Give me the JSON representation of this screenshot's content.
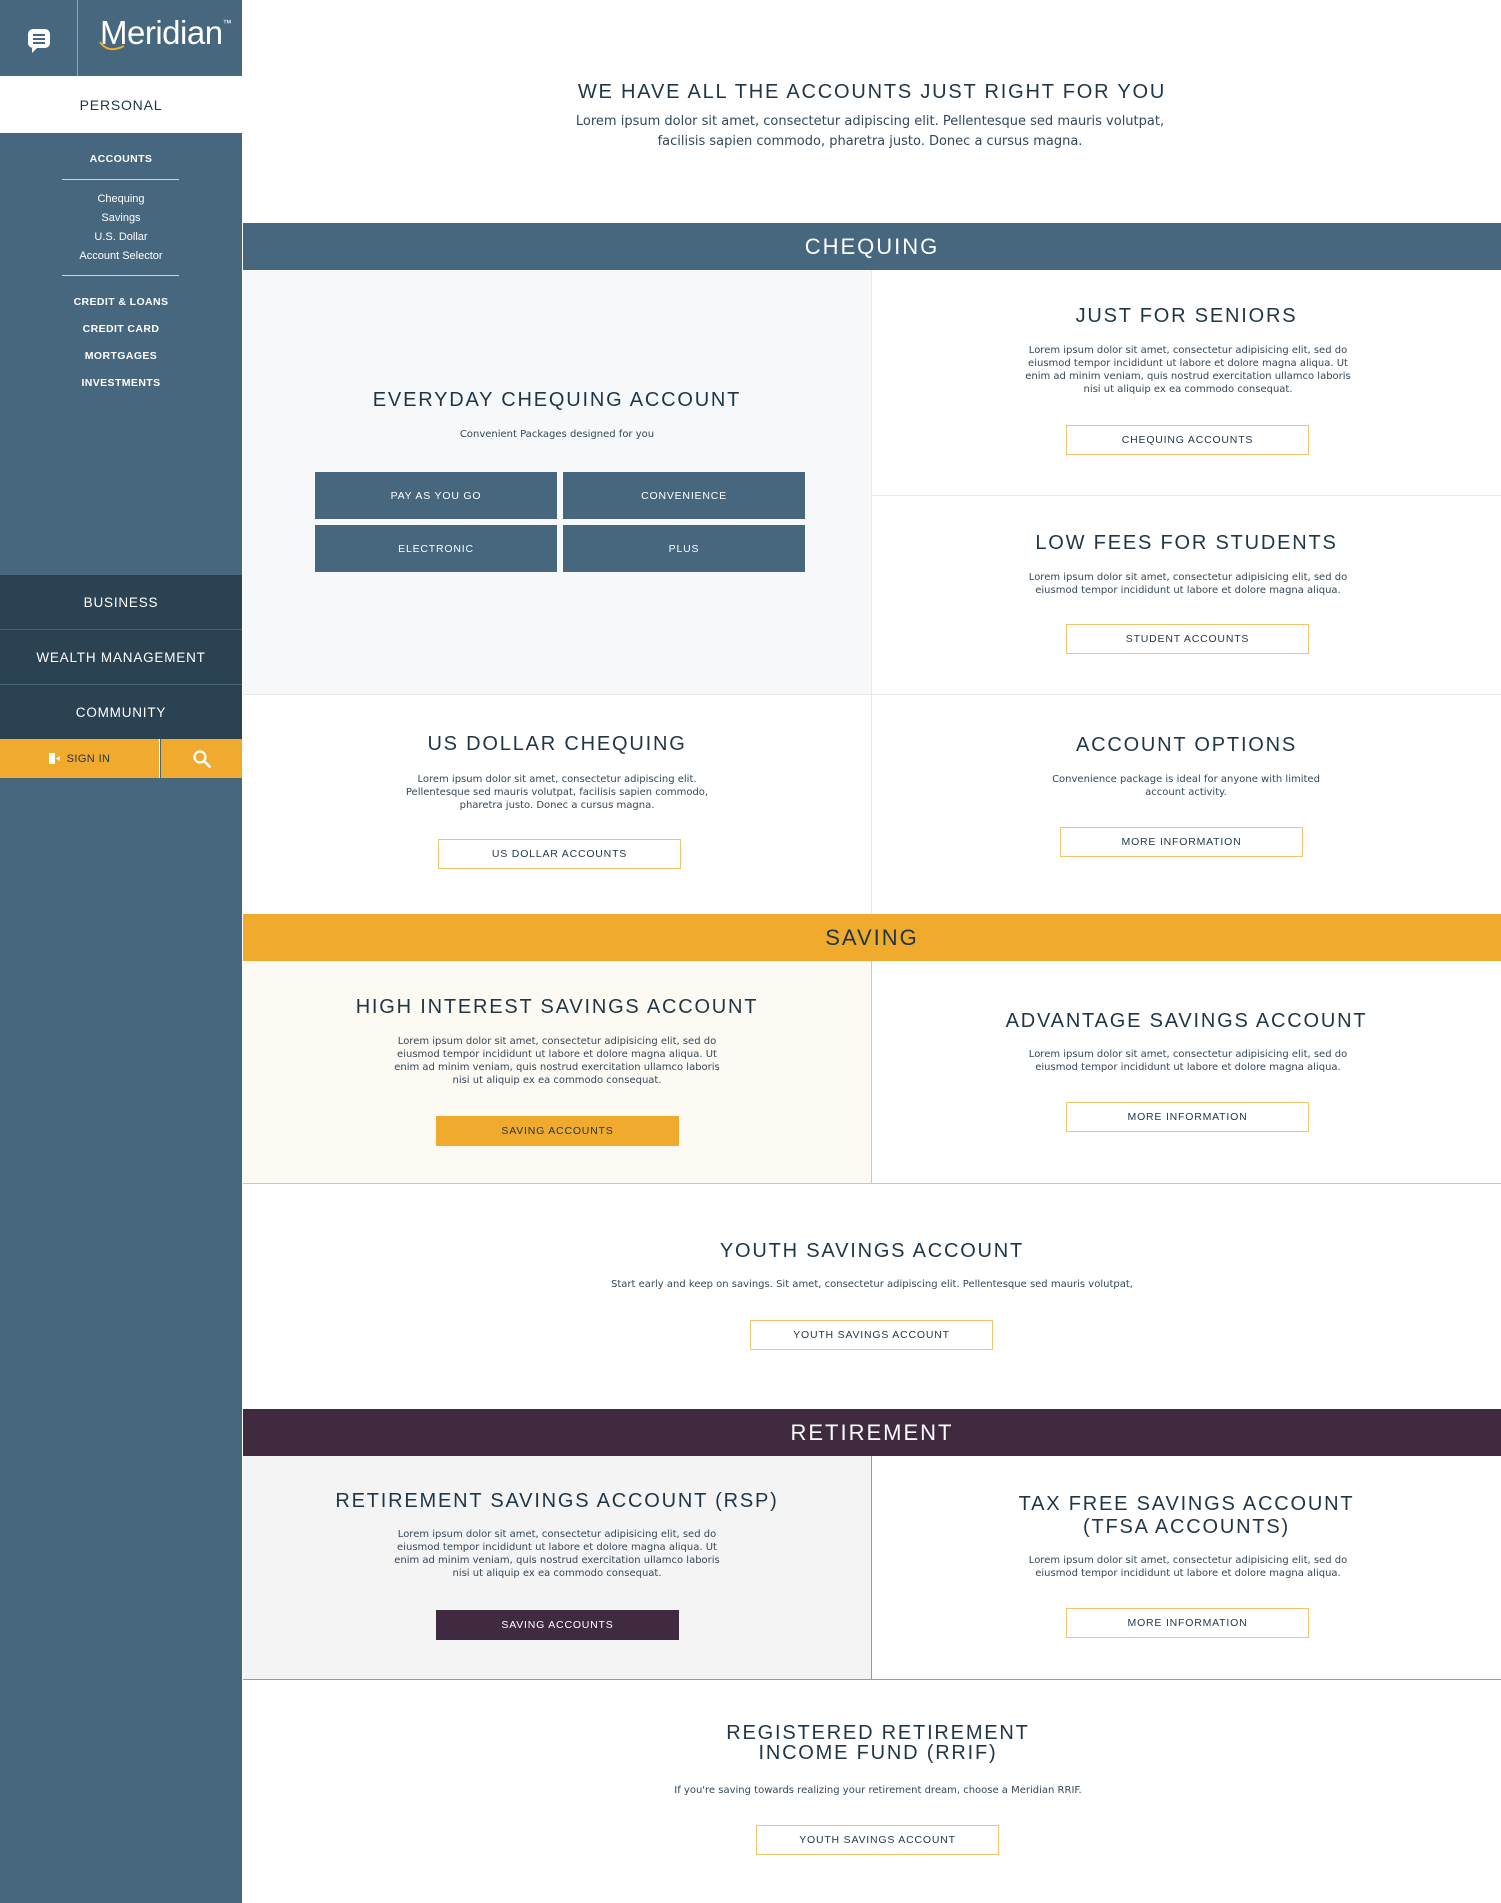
{
  "sidebar": {
    "logo_text": "Meridian",
    "logo_tm": "™",
    "personal_tab": "PERSONAL",
    "accounts_heading": "ACCOUNTS",
    "accounts_items": [
      "Chequing",
      "Savings",
      "U.S. Dollar",
      "Account Selector"
    ],
    "categories": [
      "CREDIT & LOANS",
      "CREDIT CARD",
      "MORTGAGES",
      "INVESTMENTS"
    ],
    "nav": [
      "BUSINESS",
      "WEALTH MANAGEMENT",
      "COMMUNITY"
    ],
    "sign_in": "SIGN IN",
    "icons": {
      "menu": "chat-menu-icon",
      "sign_in": "door-icon",
      "search": "search-icon"
    }
  },
  "intro": {
    "title": "WE HAVE ALL THE ACCOUNTS JUST RIGHT FOR YOU",
    "text": "Lorem ipsum dolor sit amet, consectetur adipiscing elit. Pellentesque sed mauris volutpat, facilisis sapien commodo, pharetra justo. Donec a cursus magna."
  },
  "chequing": {
    "band": "CHEQUING",
    "everyday": {
      "title": "EVERYDAY CHEQUING ACCOUNT",
      "subtitle": "Convenient Packages designed for you",
      "tiles": [
        "PAY AS YOU GO",
        "CONVENIENCE",
        "ELECTRONIC",
        "PLUS"
      ]
    },
    "seniors": {
      "title": "JUST FOR SENIORS",
      "text": "Lorem ipsum dolor sit amet, consectetur adipisicing elit, sed do eiusmod tempor incididunt ut labore et dolore magna aliqua. Ut enim ad minim veniam, quis nostrud exercitation ullamco laboris nisi ut aliquip ex ea commodo consequat.",
      "button": "CHEQUING ACCOUNTS"
    },
    "students": {
      "title": "LOW FEES FOR STUDENTS",
      "text": "Lorem ipsum dolor sit amet, consectetur adipisicing elit, sed do eiusmod tempor incididunt ut labore et dolore magna aliqua.",
      "button": "STUDENT ACCOUNTS"
    },
    "usd": {
      "title": "US DOLLAR CHEQUING",
      "text": "Lorem ipsum dolor sit amet, consectetur adipiscing elit. Pellentesque sed mauris volutpat, facilisis sapien commodo, pharetra justo. Donec a cursus magna.",
      "button": "US DOLLAR ACCOUNTS"
    },
    "options": {
      "title": "ACCOUNT OPTIONS",
      "text": "Convenience package is ideal for anyone with limited account activity.",
      "button": "MORE INFORMATION"
    }
  },
  "saving": {
    "band": "SAVING",
    "high": {
      "title": "HIGH INTEREST SAVINGS ACCOUNT",
      "text": "Lorem ipsum dolor sit amet, consectetur adipisicing elit, sed do eiusmod tempor incididunt ut labore et dolore magna aliqua. Ut enim ad minim veniam, quis nostrud exercitation ullamco laboris nisi ut aliquip ex ea commodo consequat.",
      "button": "SAVING ACCOUNTS"
    },
    "advantage": {
      "title": "ADVANTAGE SAVINGS ACCOUNT",
      "text": "Lorem ipsum dolor sit amet, consectetur adipisicing elit, sed do eiusmod tempor incididunt ut labore et dolore magna aliqua.",
      "button": "MORE INFORMATION"
    },
    "youth": {
      "title": "YOUTH SAVINGS ACCOUNT",
      "text": "Start early and keep on savings. Sit amet, consectetur adipiscing elit. Pellentesque sed mauris volutpat,",
      "button": "YOUTH SAVINGS ACCOUNT"
    }
  },
  "retirement": {
    "band": "RETIREMENT",
    "rsp": {
      "title": "RETIREMENT SAVINGS ACCOUNT (RSP)",
      "text": "Lorem ipsum dolor sit amet, consectetur adipisicing elit, sed do eiusmod tempor incididunt ut labore et dolore magna aliqua. Ut enim ad minim veniam, quis nostrud exercitation ullamco laboris nisi ut aliquip ex ea commodo consequat.",
      "button": "SAVING ACCOUNTS"
    },
    "tfsa": {
      "title_line1": "TAX FREE SAVINGS ACCOUNT",
      "title_line2": "(TFSA ACCOUNTS)",
      "text": "Lorem ipsum dolor sit amet, consectetur adipisicing elit, sed do eiusmod tempor incididunt ut labore et dolore magna aliqua.",
      "button": "MORE INFORMATION"
    },
    "rrif": {
      "title_line1": "REGISTERED RETIREMENT",
      "title_line2": "INCOME FUND (RRIF)",
      "text": "If you're saving towards realizing your retirement dream, choose a Meridian RRIF.",
      "button": "YOUTH SAVINGS ACCOUNT"
    }
  },
  "colors": {
    "slate": "#46677e",
    "navy": "#2b4253",
    "gold": "#f0aa2d",
    "plum": "#402a40",
    "ink": "#1f3647"
  }
}
